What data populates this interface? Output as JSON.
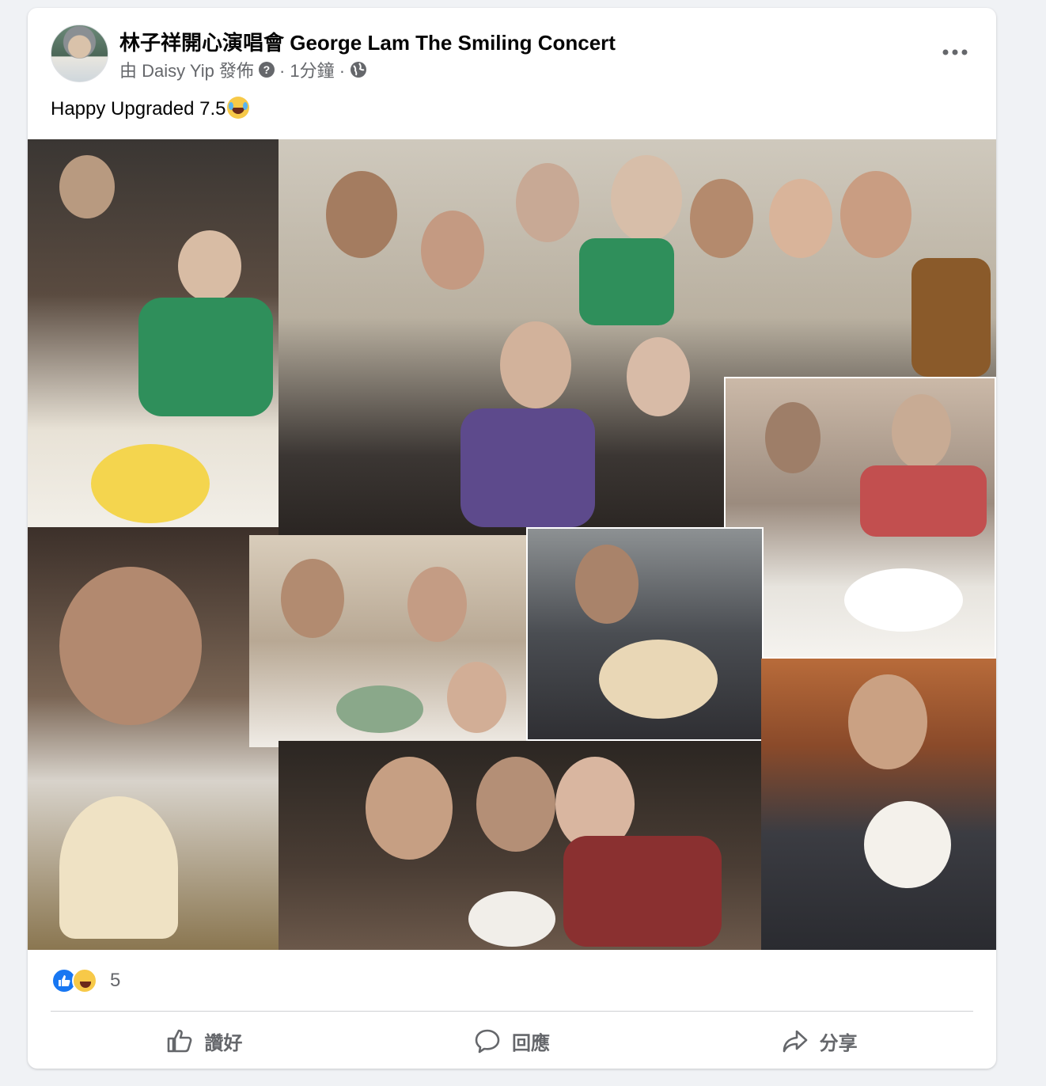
{
  "post": {
    "page_name": "林子祥開心演唱會 George Lam The Smiling Concert",
    "posted_by": "由 Daisy Yip 發佈",
    "time_ago": "· 1分鐘 ·",
    "text": "Happy Upgraded 7.5",
    "emoji_icon": "laughing-crying-emoji"
  },
  "reactions": {
    "icons": [
      "like-icon",
      "haha-icon"
    ],
    "count": "5"
  },
  "actions": {
    "like_label": "讚好",
    "comment_label": "回應",
    "share_label": "分享"
  },
  "colors": {
    "primary_text": "#050505",
    "secondary_text": "#65676b",
    "like_blue": "#1877f2",
    "background": "#f0f2f5"
  }
}
